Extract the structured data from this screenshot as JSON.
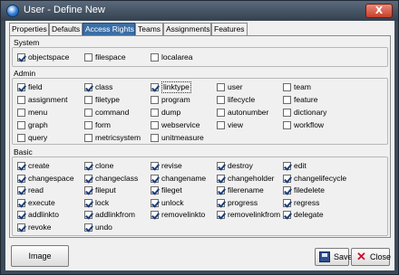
{
  "window": {
    "title": "User - Define New",
    "close_glyph": "X"
  },
  "tabs": [
    "Properties",
    "Defaults",
    "Access Rights",
    "Teams",
    "Assignments",
    "Features"
  ],
  "active_tab": "Access Rights",
  "groups": {
    "system": {
      "title": "System",
      "items": [
        {
          "label": "objectspace",
          "checked": true
        },
        {
          "label": "filespace",
          "checked": false
        },
        {
          "label": "localarea",
          "checked": false
        }
      ]
    },
    "admin": {
      "title": "Admin",
      "rows": [
        [
          {
            "label": "field",
            "checked": true
          },
          {
            "label": "class",
            "checked": true
          },
          {
            "label": "linktype",
            "checked": true
          },
          {
            "label": "user",
            "checked": false
          },
          {
            "label": "team",
            "checked": false
          }
        ],
        [
          {
            "label": "assignment",
            "checked": false
          },
          {
            "label": "filetype",
            "checked": false
          },
          {
            "label": "program",
            "checked": false
          },
          {
            "label": "lifecycle",
            "checked": false
          },
          {
            "label": "feature",
            "checked": false
          }
        ],
        [
          {
            "label": "menu",
            "checked": false
          },
          {
            "label": "command",
            "checked": false
          },
          {
            "label": "dump",
            "checked": false
          },
          {
            "label": "autonumber",
            "checked": false
          },
          {
            "label": "dictionary",
            "checked": false
          }
        ],
        [
          {
            "label": "graph",
            "checked": false
          },
          {
            "label": "form",
            "checked": false
          },
          {
            "label": "webservice",
            "checked": false
          },
          {
            "label": "view",
            "checked": false
          },
          {
            "label": "workflow",
            "checked": false
          }
        ],
        [
          {
            "label": "query",
            "checked": false
          },
          {
            "label": "metricsystem",
            "checked": false
          },
          {
            "label": "unitmeasure",
            "checked": false
          }
        ]
      ]
    },
    "basic": {
      "title": "Basic",
      "rows": [
        [
          {
            "label": "create",
            "checked": true
          },
          {
            "label": "clone",
            "checked": true
          },
          {
            "label": "revise",
            "checked": true
          },
          {
            "label": "destroy",
            "checked": true
          },
          {
            "label": "edit",
            "checked": true
          }
        ],
        [
          {
            "label": "changespace",
            "checked": true
          },
          {
            "label": "changeclass",
            "checked": true
          },
          {
            "label": "changename",
            "checked": true
          },
          {
            "label": "changeholder",
            "checked": true
          },
          {
            "label": "changelifecycle",
            "checked": true
          }
        ],
        [
          {
            "label": "read",
            "checked": true
          },
          {
            "label": "fileput",
            "checked": true
          },
          {
            "label": "fileget",
            "checked": true
          },
          {
            "label": "filerename",
            "checked": true
          },
          {
            "label": "filedelete",
            "checked": true
          }
        ],
        [
          {
            "label": "execute",
            "checked": true
          },
          {
            "label": "lock",
            "checked": true
          },
          {
            "label": "unlock",
            "checked": true
          },
          {
            "label": "progress",
            "checked": true
          },
          {
            "label": "regress",
            "checked": true
          }
        ],
        [
          {
            "label": "addlinkto",
            "checked": true
          },
          {
            "label": "addlinkfrom",
            "checked": true
          },
          {
            "label": "removelinkto",
            "checked": true
          },
          {
            "label": "removelinkfrom",
            "checked": true
          },
          {
            "label": "delegate",
            "checked": true
          }
        ],
        [
          {
            "label": "revoke",
            "checked": true
          },
          {
            "label": "undo",
            "checked": true
          }
        ]
      ]
    }
  },
  "buttons": {
    "image": "Image",
    "save": "Save",
    "close": "Close"
  },
  "icons": {
    "app": "app-globe-icon",
    "save": "save-disk-icon",
    "close": "close-x-icon"
  },
  "colors": {
    "active_tab": "#3a6ea5",
    "titlebar": "#3c4a5a",
    "check": "#1a3c7a",
    "close_icon": "#c8102e"
  }
}
